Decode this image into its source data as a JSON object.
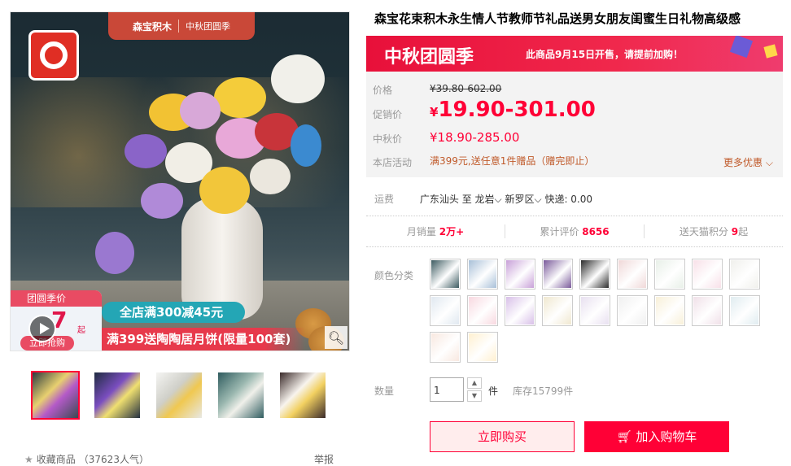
{
  "gallery": {
    "frame_brand": "森宝积木",
    "frame_sub": "中秋团圆季",
    "badge_title": "团圆季价",
    "badge_number": "7",
    "badge_unit": "起",
    "badge_button": "立即抢购",
    "promo_line1": "全店满300减45元",
    "promo_line2": "满399送陶陶居月饼(限量100套)",
    "thumbnails": [
      "thumb-1",
      "thumb-2",
      "thumb-3",
      "thumb-4",
      "thumb-5"
    ],
    "favorite_label": "收藏商品",
    "favorite_count": "（37623人气）",
    "report_label": "举报"
  },
  "product": {
    "title": "森宝花束积木永生情人节教师节礼品送男女朋友闺蜜生日礼物高级感"
  },
  "banner": {
    "logo": "中秋团圆季",
    "message": "此商品9月15日开售，请提前加购！"
  },
  "price": {
    "list_label": "价格",
    "list_value": "¥39.80-602.00",
    "promo_label": "促销价",
    "promo_currency": "¥",
    "promo_value": "19.90-301.00",
    "festival_label": "中秋价",
    "festival_value": "¥18.90-285.00",
    "activity_label": "本店活动",
    "activity_value": "满399元,送任意1件赠品（赠完即止）",
    "more_label": "更多优惠"
  },
  "shipping": {
    "label": "运费",
    "from": "广东汕头",
    "to_word": "至",
    "city": "龙岩",
    "district": "新罗区",
    "fee": "快递: 0.00"
  },
  "stats": {
    "monthly_label": "月销量",
    "monthly_value": "2万+",
    "reviews_label": "累计评价",
    "reviews_value": "8656",
    "points_label": "送天猫积分",
    "points_value": "9",
    "points_unit": "起"
  },
  "color": {
    "label": "颜色分类",
    "swatch_colors": [
      "#3c5a60",
      "#a8c0d8",
      "#c8a0d8",
      "#7a5a9a",
      "#2a2a2a",
      "#f0d8d8",
      "#e8f0e8",
      "#f8e0e8",
      "#f0f0ec",
      "#e0e8f0",
      "#f8d8e0",
      "#d8c0e8",
      "#f0e8d0",
      "#e8e0f0",
      "#f0f0f0",
      "#f8f0d8",
      "#f0e0e8",
      "#e0ecf0",
      "#f8e8e0",
      "#fff0d0"
    ]
  },
  "quantity": {
    "label": "数量",
    "value": "1",
    "unit": "件",
    "stock": "库存15799件"
  },
  "actions": {
    "buy_now": "立即购买",
    "add_to_cart": "加入购物车"
  }
}
